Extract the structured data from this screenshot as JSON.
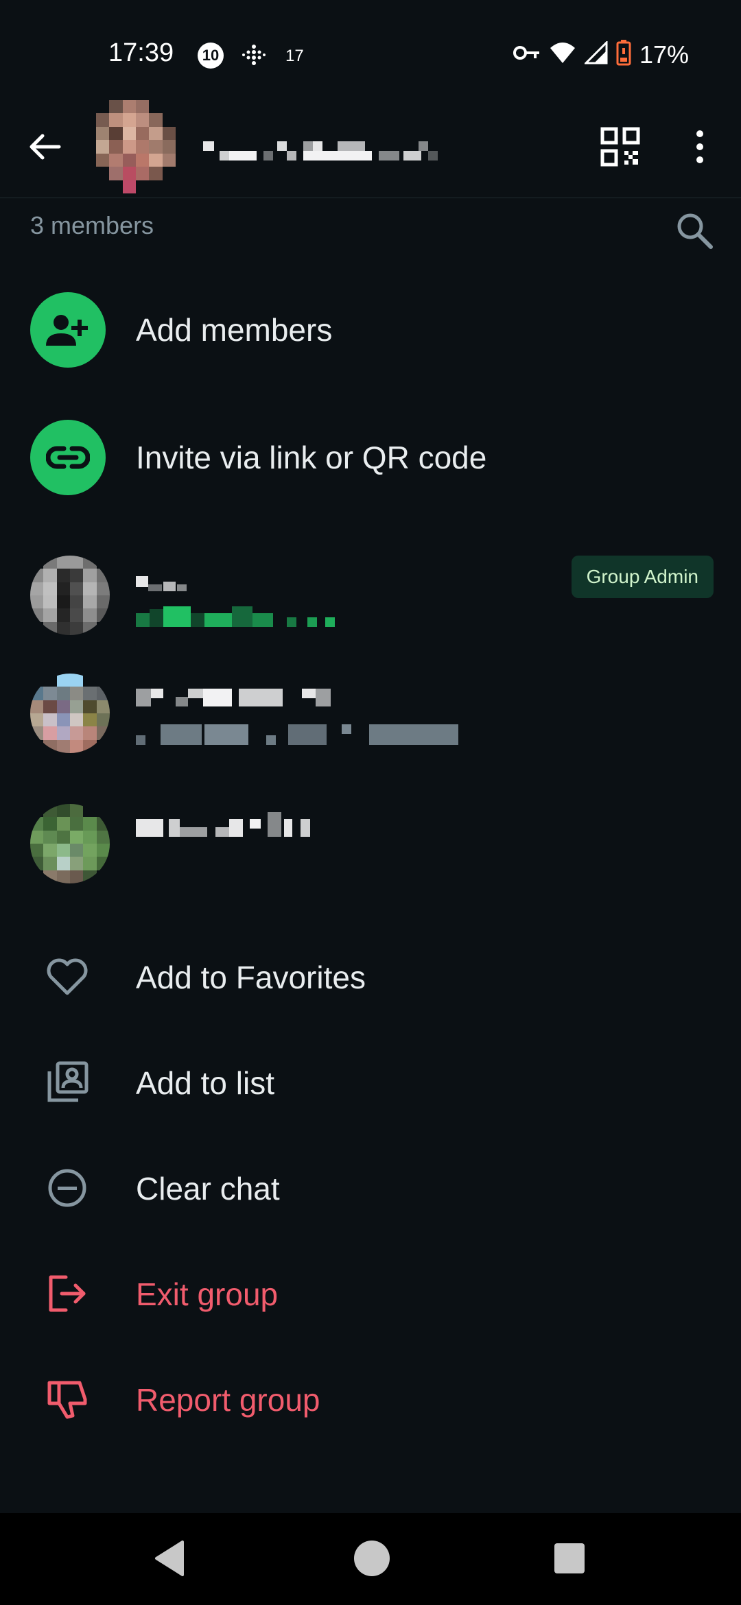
{
  "status_bar": {
    "time": "17:39",
    "notif_badge": "10",
    "notif_count": "17",
    "battery_percent": "17%"
  },
  "header": {
    "back_icon": "arrow-left-icon",
    "qr_icon": "qr-code-icon",
    "more_icon": "more-vertical-icon"
  },
  "members": {
    "count_label": "3 members",
    "search_icon": "search-icon"
  },
  "actions": [
    {
      "label": "Add members",
      "icon": "add-person-icon"
    },
    {
      "label": "Invite via link or QR code",
      "icon": "link-icon"
    }
  ],
  "member_list": [
    {
      "badge": "Group Admin"
    }
  ],
  "options": [
    {
      "label": "Add to Favorites",
      "icon": "heart-icon"
    },
    {
      "label": "Add to list",
      "icon": "contact-list-icon"
    },
    {
      "label": "Clear chat",
      "icon": "clear-circle-icon"
    },
    {
      "label": "Exit group",
      "icon": "exit-icon",
      "danger": true
    },
    {
      "label": "Report group",
      "icon": "thumbs-down-icon",
      "danger": true
    }
  ],
  "colors": {
    "background": "#0b1014",
    "accent_green": "#21c063",
    "danger_red": "#f15c6d",
    "secondary_text": "#8696a0",
    "badge_bg": "#103529"
  }
}
